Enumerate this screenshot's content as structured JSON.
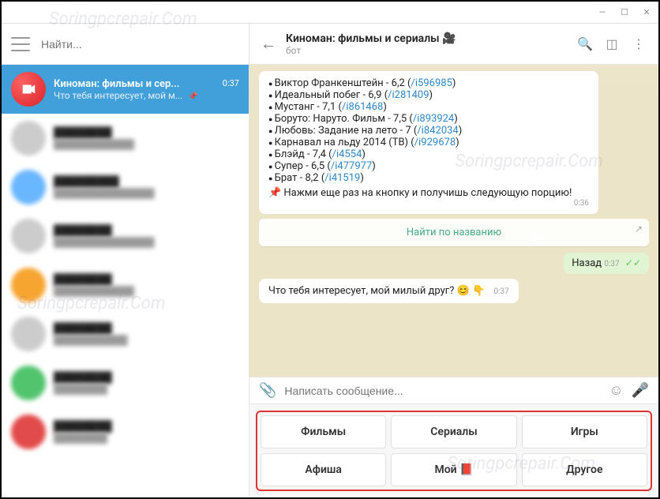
{
  "watermarks": [
    "Soringpcrepair.Com",
    "Soringpcrepair.Com",
    "Soringpcrepair.Com",
    "Soringpcrepair.Com"
  ],
  "search": {
    "placeholder": "Найти..."
  },
  "active_chat": {
    "title": "Киноман: фильмы и сер...",
    "time": "0:37",
    "subtitle": "Что тебя интересует, мой м..."
  },
  "header": {
    "title": "Киноман: фильмы и сериалы 🎥",
    "subtitle": "бот"
  },
  "message": {
    "items": [
      {
        "name": "Виктор Франкенштейн",
        "rating": "6,2",
        "link": "/i596985"
      },
      {
        "name": "Идеальный побег",
        "rating": "6,9",
        "link": "/i281409"
      },
      {
        "name": "Мустанг",
        "rating": "7,1",
        "link": "/i861468"
      },
      {
        "name": "Боруто: Наруто. Фильм",
        "rating": "7,5",
        "link": "/i893924"
      },
      {
        "name": "Любовь: Задание на лето",
        "rating": "7",
        "link": "/i842034"
      },
      {
        "name": "Карнавал на льду 2014 (ТВ)",
        "rating": "",
        "link": "/i929678"
      },
      {
        "name": "Блэйд",
        "rating": "7,4",
        "link": "/i4554"
      },
      {
        "name": "Супер",
        "rating": "6,5",
        "link": "/i477977"
      },
      {
        "name": "Брат",
        "rating": "8,2",
        "link": "/i41519"
      }
    ],
    "footer": "📌 Нажми еще раз на кнопку и получишь следующую порцию!",
    "time": "0:36"
  },
  "inline_button": {
    "label": "Найти по названию"
  },
  "out_message": {
    "text": "Назад",
    "time": "0:37"
  },
  "in_message2": {
    "text": "Что тебя интересует, мой милый друг? 😊 👇",
    "time": "0:37"
  },
  "input": {
    "placeholder": "Написать сообщение..."
  },
  "keyboard": {
    "buttons": [
      "Фильмы",
      "Сериалы",
      "Игры",
      "Афиша",
      "Мой 📕",
      "Другое"
    ]
  }
}
